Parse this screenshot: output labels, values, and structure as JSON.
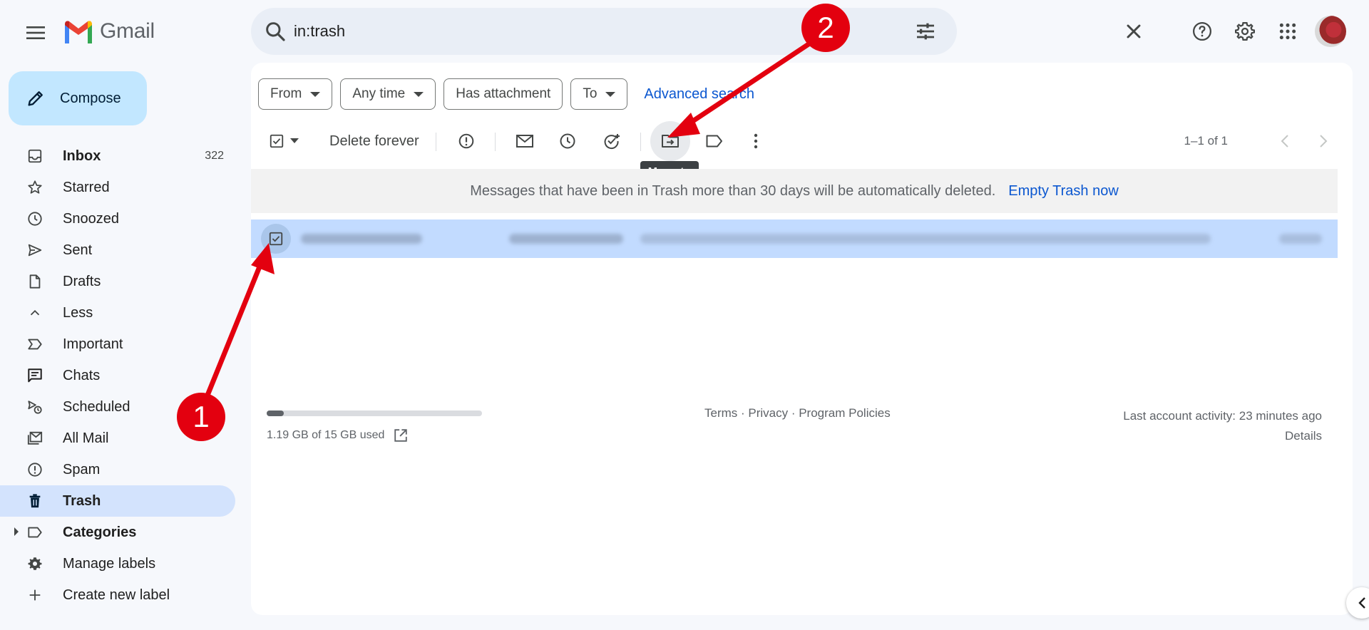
{
  "app": {
    "brand": "Gmail"
  },
  "search": {
    "query": "in:trash"
  },
  "compose": {
    "label": "Compose"
  },
  "sidebar": {
    "items": [
      {
        "label": "Inbox",
        "count": "322",
        "icon": "inbox-icon"
      },
      {
        "label": "Starred",
        "icon": "star-icon"
      },
      {
        "label": "Snoozed",
        "icon": "clock-icon"
      },
      {
        "label": "Sent",
        "icon": "send-icon"
      },
      {
        "label": "Drafts",
        "icon": "draft-icon"
      },
      {
        "label": "Less",
        "icon": "chevron-up-icon"
      },
      {
        "label": "Important",
        "icon": "important-icon"
      },
      {
        "label": "Chats",
        "icon": "chat-icon"
      },
      {
        "label": "Scheduled",
        "icon": "scheduled-icon"
      },
      {
        "label": "All Mail",
        "icon": "all-mail-icon"
      },
      {
        "label": "Spam",
        "icon": "spam-icon"
      },
      {
        "label": "Trash",
        "icon": "trash-icon",
        "active": true
      },
      {
        "label": "Categories",
        "icon": "label-icon"
      },
      {
        "label": "Manage labels",
        "icon": "gear-icon"
      },
      {
        "label": "Create new label",
        "icon": "plus-icon"
      }
    ]
  },
  "filters": {
    "chips": [
      "From",
      "Any time",
      "Has attachment",
      "To"
    ],
    "advanced_search": "Advanced search"
  },
  "toolbar": {
    "delete_forever": "Delete forever",
    "tooltip": "Move to",
    "pager": "1–1 of 1"
  },
  "trash_notice": {
    "message": "Messages that have been in Trash more than 30 days will be automatically deleted.",
    "action": "Empty Trash now"
  },
  "footer": {
    "storage_text": "1.19 GB of 15 GB used",
    "storage_fraction": 0.079,
    "links": "Terms · Privacy · Program Policies",
    "activity": "Last account activity: 23 minutes ago",
    "details": "Details"
  },
  "annotations": {
    "step1": "1",
    "step2": "2"
  },
  "colors": {
    "accent": "#0b57d0",
    "selected_row": "#c2dbff",
    "active_nav": "#d3e3fd",
    "annotation": "#e3000f"
  }
}
